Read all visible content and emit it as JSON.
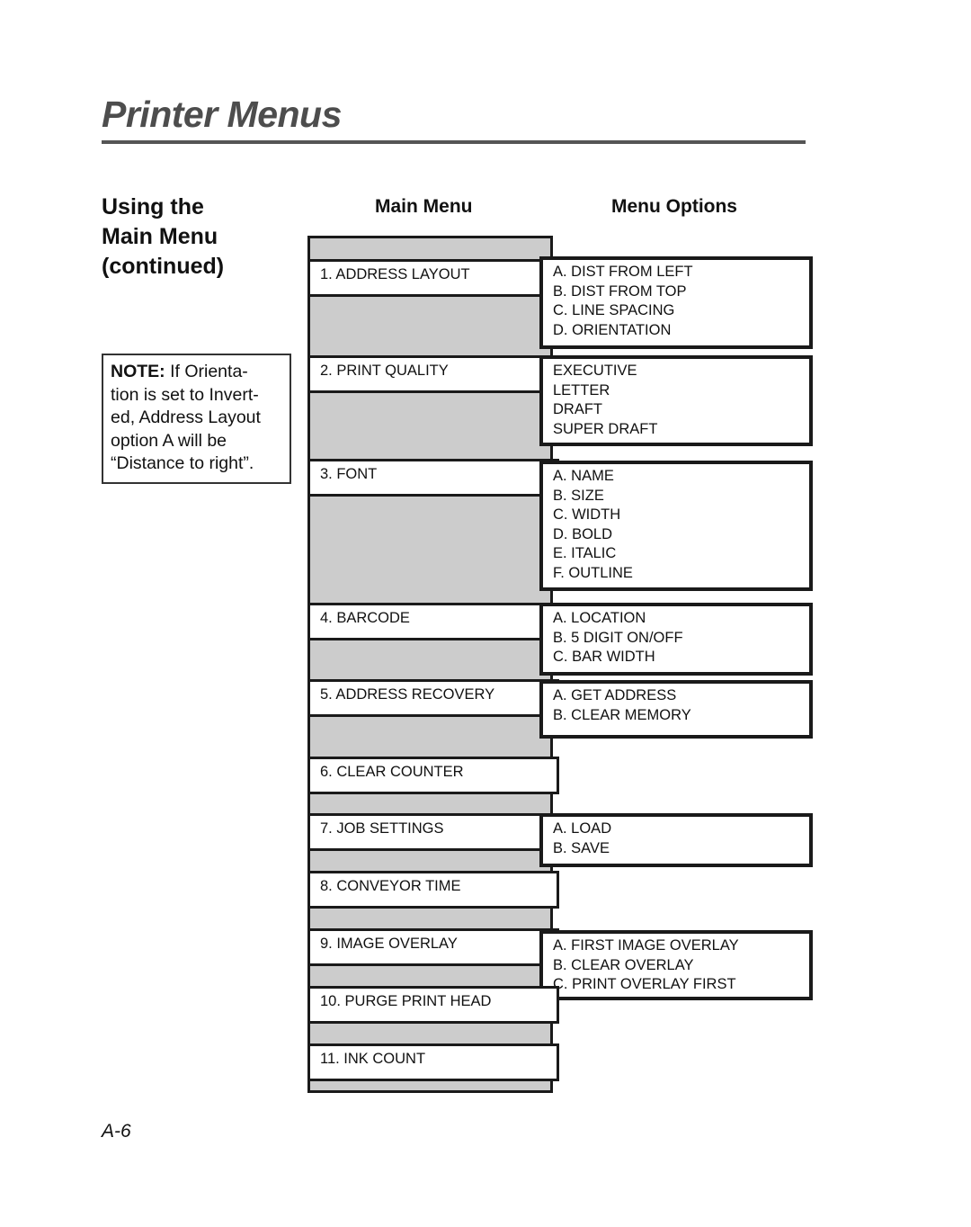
{
  "page": {
    "title": "Printer Menus",
    "page_number": "A-6"
  },
  "side": {
    "heading_lines": [
      "Using the",
      "Main Menu",
      "(continued)"
    ],
    "note": {
      "label": "NOTE:",
      "lines": [
        " If Orienta-",
        "tion is set to Invert-",
        "ed, Address Layout",
        "option A will be",
        "“Distance to right”."
      ]
    }
  },
  "columns": {
    "main_menu": "Main Menu",
    "menu_options": "Menu Options"
  },
  "menu": [
    {
      "label": "1.  ADDRESS LAYOUT",
      "options": [
        "A.  DIST FROM LEFT",
        "B.  DIST FROM TOP",
        "C.  LINE SPACING",
        "D.  ORIENTATION"
      ]
    },
    {
      "label": "2.  PRINT QUALITY",
      "options": [
        "EXECUTIVE",
        "LETTER",
        "DRAFT",
        "SUPER DRAFT"
      ]
    },
    {
      "label": "3.  FONT",
      "options": [
        "A.  NAME",
        "B.  SIZE",
        "C.  WIDTH",
        "D.  BOLD",
        "E.  ITALIC",
        "F.  OUTLINE"
      ]
    },
    {
      "label": "4.  BARCODE",
      "options": [
        "A.  LOCATION",
        "B.  5 DIGIT ON/OFF",
        "C. BAR WIDTH"
      ]
    },
    {
      "label": "5.  ADDRESS RECOVERY",
      "options": [
        "A.  GET ADDRESS",
        "B.  CLEAR MEMORY"
      ]
    },
    {
      "label": "6.  CLEAR COUNTER",
      "options": []
    },
    {
      "label": "7.  JOB SETTINGS",
      "options": [
        "A.  LOAD",
        "B.  SAVE"
      ]
    },
    {
      "label": "8. CONVEYOR TIME",
      "options": []
    },
    {
      "label": "9. IMAGE OVERLAY",
      "options": [
        "A. FIRST IMAGE OVERLAY",
        "B. CLEAR OVERLAY",
        "C. PRINT OVERLAY FIRST"
      ]
    },
    {
      "label": "10. PURGE PRINT HEAD",
      "options": []
    },
    {
      "label": "11. INK COUNT",
      "options": []
    }
  ]
}
